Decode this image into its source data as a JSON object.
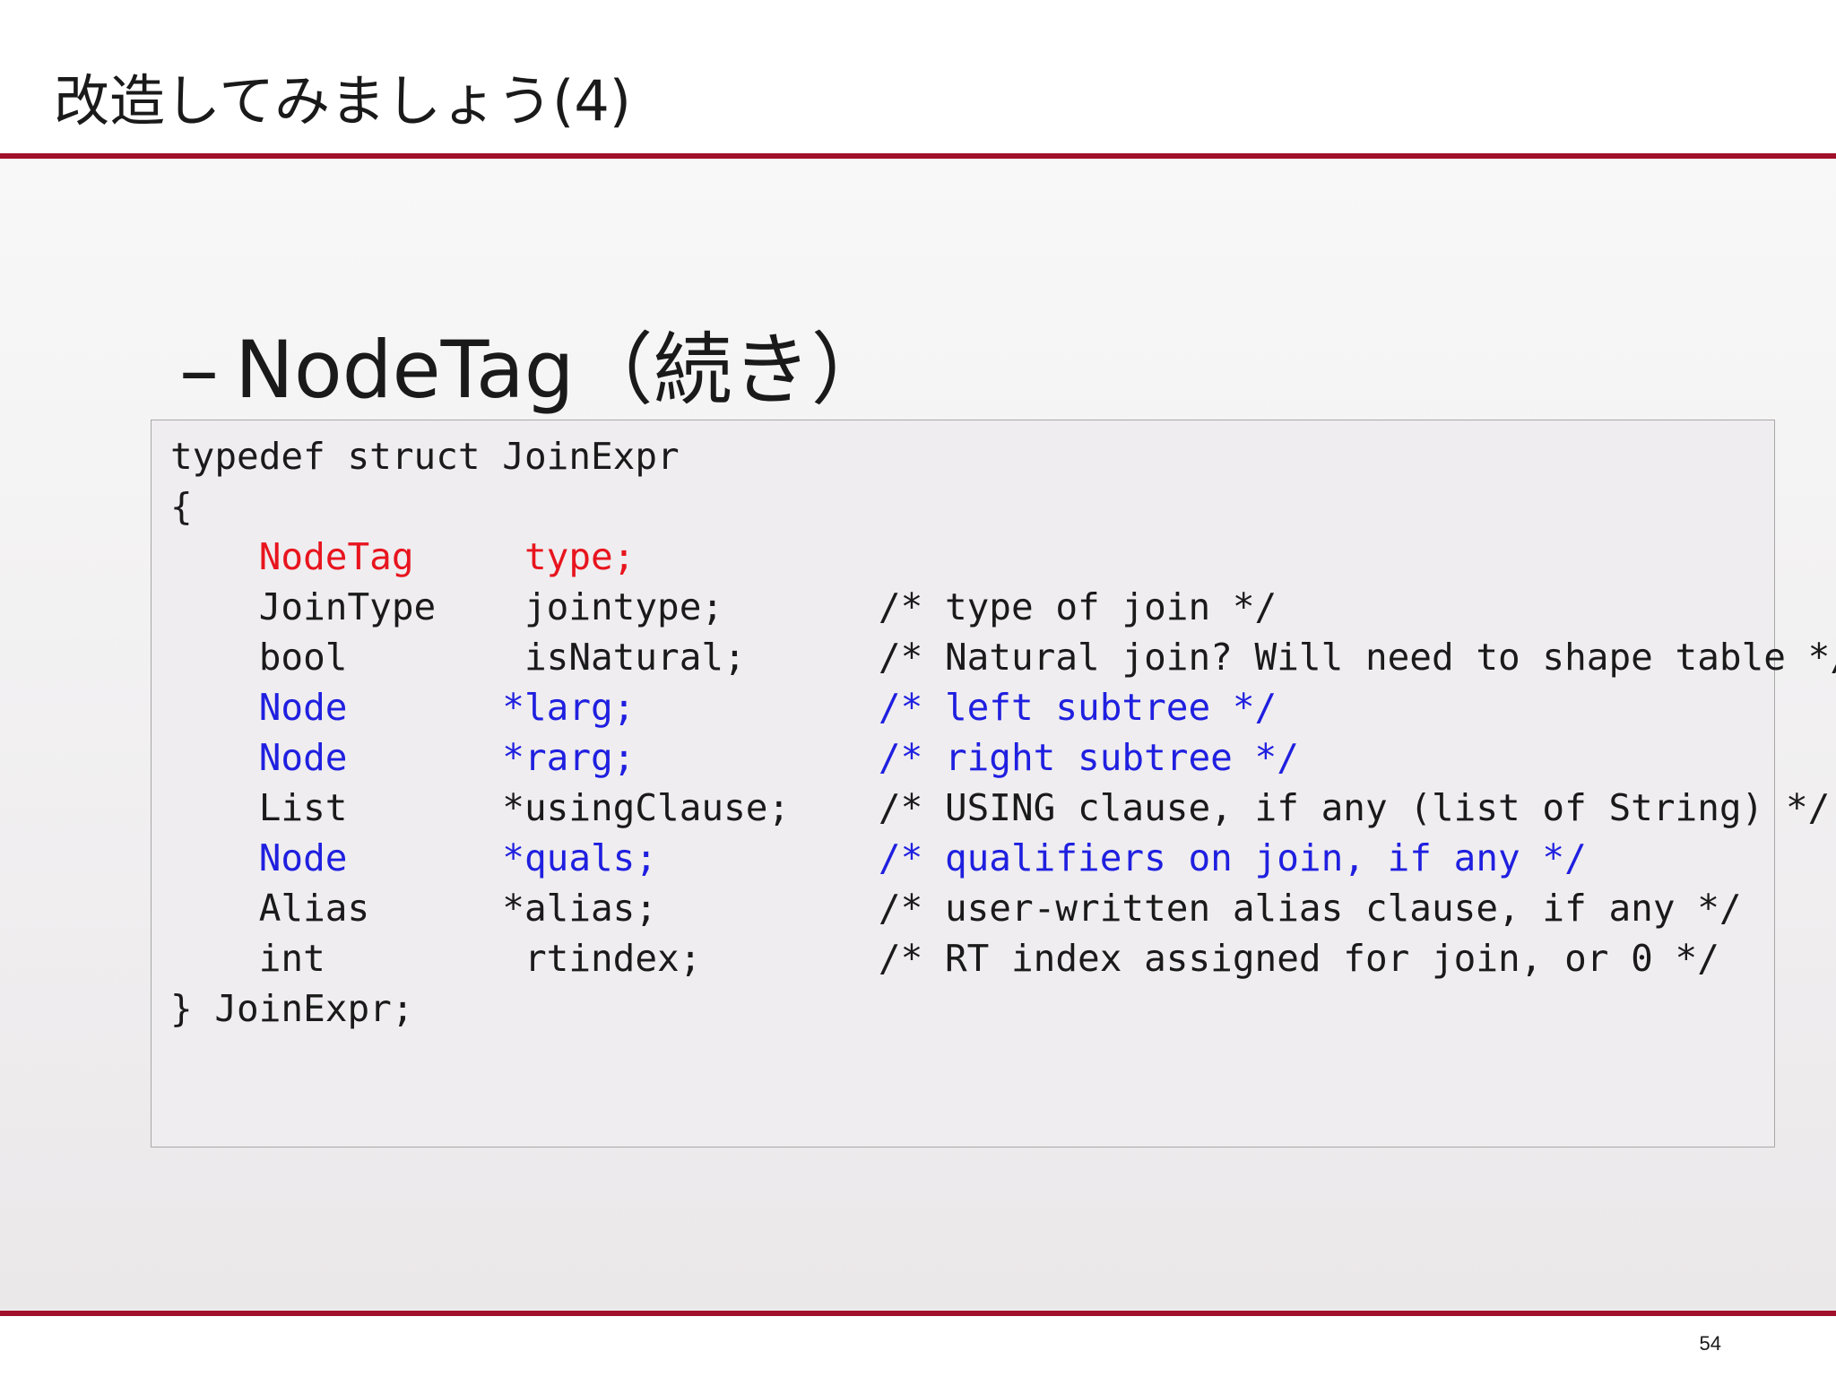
{
  "slide": {
    "title": "改造してみましょう(4)",
    "subheading_dash": "–",
    "subheading": "NodeTag（続き）",
    "page_number": "54"
  },
  "colors": {
    "accent_rule": "#a0102b",
    "highlight_red": "#e8141e",
    "highlight_blue": "#1f1fe0"
  },
  "code": {
    "lines": [
      {
        "text": "typedef struct JoinExpr",
        "color": "default"
      },
      {
        "text": "{",
        "color": "default"
      },
      {
        "text": "    NodeTag     type;",
        "color": "red"
      },
      {
        "text": "    JoinType    jointype;       /* type of join */",
        "color": "default"
      },
      {
        "text": "    bool        isNatural;      /* Natural join? Will need to shape table */",
        "color": "default"
      },
      {
        "text": "    Node       *larg;           /* left subtree */",
        "color": "blue"
      },
      {
        "text": "    Node       *rarg;           /* right subtree */",
        "color": "blue"
      },
      {
        "text": "    List       *usingClause;    /* USING clause, if any (list of String) */",
        "color": "default"
      },
      {
        "text": "    Node       *quals;          /* qualifiers on join, if any */",
        "color": "blue"
      },
      {
        "text": "    Alias      *alias;          /* user-written alias clause, if any */",
        "color": "default"
      },
      {
        "text": "    int         rtindex;        /* RT index assigned for join, or 0 */",
        "color": "default"
      },
      {
        "text": "} JoinExpr;",
        "color": "default"
      }
    ]
  }
}
